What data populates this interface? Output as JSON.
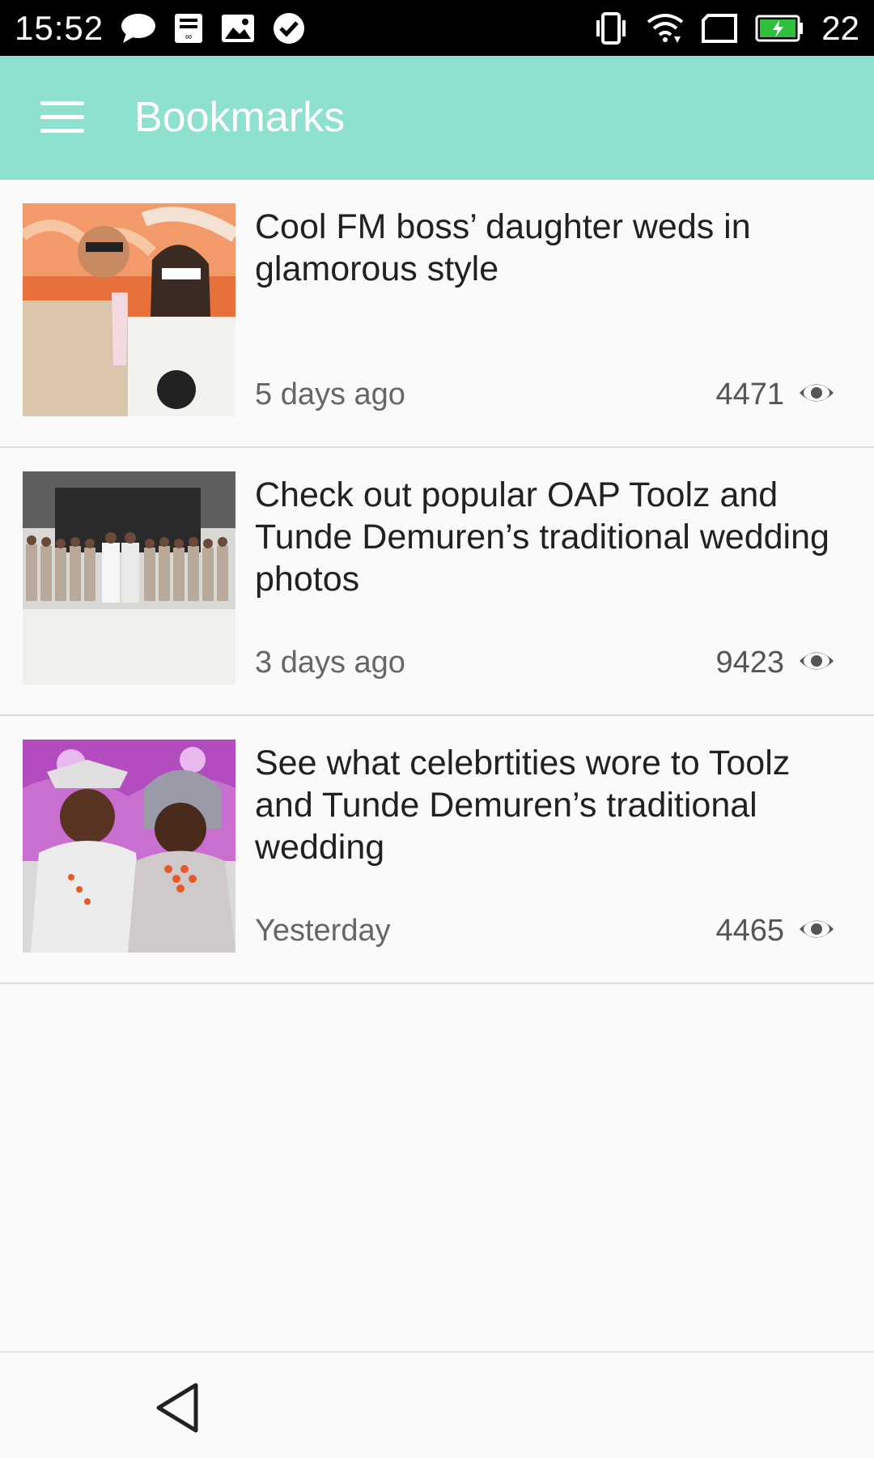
{
  "status_bar": {
    "time": "15:52",
    "battery_level": "22",
    "left_icons": [
      "message-icon",
      "sim-card-icon",
      "image-icon",
      "check-circle-icon"
    ],
    "right_icons": [
      "vibrate-icon",
      "wifi-icon",
      "no-sim-icon",
      "battery-charging-icon"
    ]
  },
  "app_bar": {
    "title": "Bookmarks",
    "background_color": "#8ee0cf",
    "menu_icon": "hamburger-menu-icon"
  },
  "bookmarks": [
    {
      "title": "Cool FM boss’ daughter weds in glamorous style",
      "time": "5 days ago",
      "views": "4471",
      "thumbnail": "couple-photo-booth-props"
    },
    {
      "title": "Check out popular OAP Toolz and Tunde Demuren’s traditional wedding photos",
      "time": "3 days ago",
      "views": "9423",
      "thumbnail": "group-wedding-photo"
    },
    {
      "title": "See what celebrtities wore to Toolz and Tunde Demuren’s traditional wedding",
      "time": "Yesterday",
      "views": "4465",
      "thumbnail": "couple-traditional-attire"
    }
  ],
  "nav_bar": {
    "back_icon": "back-triangle-icon"
  }
}
